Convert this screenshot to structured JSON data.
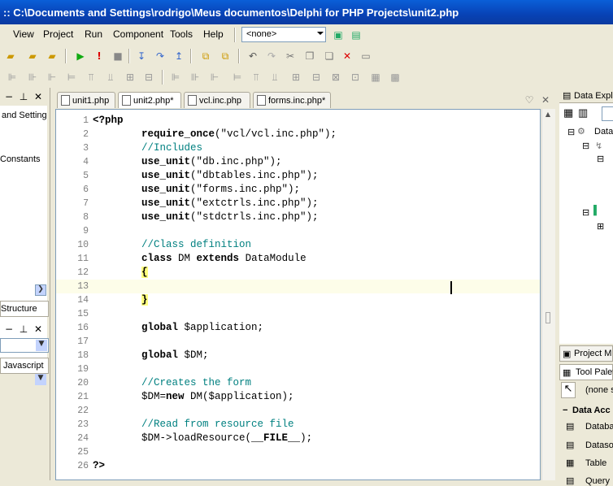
{
  "window": {
    "title": ":: C:\\Documents and Settings\\rodrigo\\Meus documentos\\Delphi for PHP Projects\\unit2.php"
  },
  "menu": [
    "View",
    "Project",
    "Run",
    "Component",
    "Tools",
    "Help"
  ],
  "combo": {
    "value": "<none>"
  },
  "left_panel": {
    "item1": "and Setting",
    "item2": "Constants",
    "tab_structure": "Structure",
    "tab_javascript": "Javascript"
  },
  "tabs": [
    {
      "label": "unit1.php",
      "active": false
    },
    {
      "label": "unit2.php*",
      "active": true
    },
    {
      "label": "vcl.inc.php",
      "active": false
    },
    {
      "label": "forms.inc.php*",
      "active": false
    }
  ],
  "code_lines": [
    {
      "n": "1",
      "text": "<?php"
    },
    {
      "n": "2",
      "text": "        require_once(\"vcl/vcl.inc.php\");"
    },
    {
      "n": "3",
      "text": "        //Includes"
    },
    {
      "n": "4",
      "text": "        use_unit(\"db.inc.php\");"
    },
    {
      "n": "5",
      "text": "        use_unit(\"dbtables.inc.php\");"
    },
    {
      "n": "6",
      "text": "        use_unit(\"forms.inc.php\");"
    },
    {
      "n": "7",
      "text": "        use_unit(\"extctrls.inc.php\");"
    },
    {
      "n": "8",
      "text": "        use_unit(\"stdctrls.inc.php\");"
    },
    {
      "n": "9",
      "text": ""
    },
    {
      "n": "10",
      "text": "        //Class definition"
    },
    {
      "n": "11",
      "text": "        class DM extends DataModule"
    },
    {
      "n": "12",
      "text": "        {"
    },
    {
      "n": "13",
      "text": ""
    },
    {
      "n": "14",
      "text": "        }"
    },
    {
      "n": "15",
      "text": ""
    },
    {
      "n": "16",
      "text": "        global $application;"
    },
    {
      "n": "17",
      "text": ""
    },
    {
      "n": "18",
      "text": "        global $DM;"
    },
    {
      "n": "19",
      "text": ""
    },
    {
      "n": "20",
      "text": "        //Creates the form"
    },
    {
      "n": "21",
      "text": "        $DM=new DM($application);"
    },
    {
      "n": "22",
      "text": ""
    },
    {
      "n": "23",
      "text": "        //Read from resource file"
    },
    {
      "n": "24",
      "text": "        $DM->loadResource(__FILE__);"
    },
    {
      "n": "25",
      "text": ""
    },
    {
      "n": "26",
      "text": "?>"
    }
  ],
  "right_panel": {
    "data_explorer": "Data Expl",
    "tree_root": "Data",
    "project": "Project M",
    "tool_palette": "Tool Palet",
    "none_label": "(none s",
    "data_access": "Data Acc",
    "items": [
      "Databa",
      "Dataso",
      "Table",
      "Query"
    ]
  }
}
